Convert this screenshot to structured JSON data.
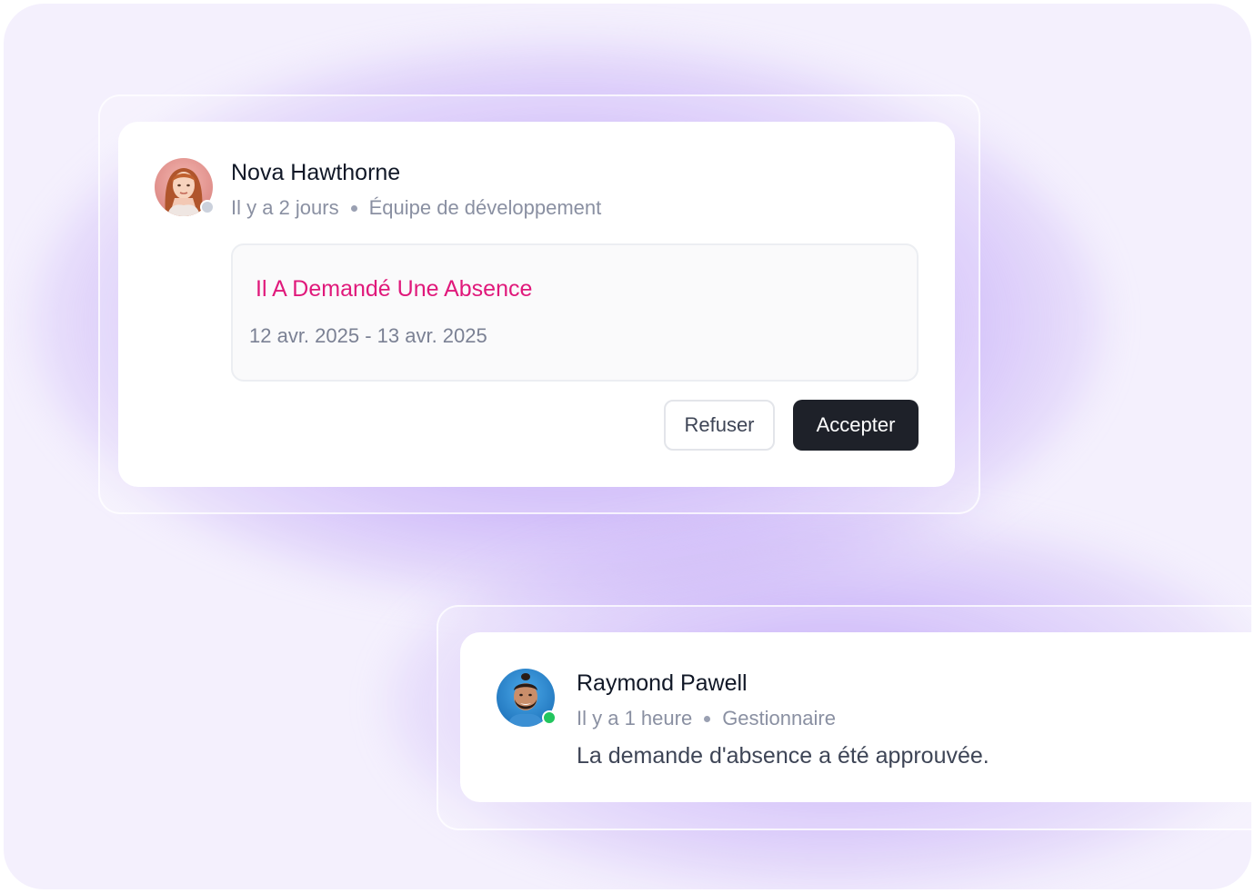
{
  "request_card": {
    "user_name": "Nova Hawthorne",
    "time_ago": "Il y a 2 jours",
    "team": "Équipe de développement",
    "status_color": "#cbd1dc",
    "request_title": "Il A Demandé Une Absence",
    "request_dates": "12 avr. 2025 - 13 avr. 2025",
    "refuse_label": "Refuser",
    "accept_label": "Accepter",
    "accent_color": "#e0197b"
  },
  "approval_card": {
    "user_name": "Raymond Pawell",
    "time_ago": "Il y a 1 heure",
    "role": "Gestionnaire",
    "status_color": "#22c55e",
    "message": "La demande d'absence a été approuvée."
  }
}
